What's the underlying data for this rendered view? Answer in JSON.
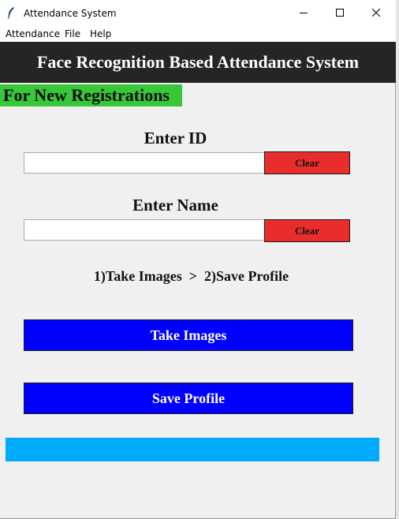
{
  "window": {
    "title": "Attendance System",
    "controls": {
      "minimize": "minimize-icon",
      "maximize": "maximize-icon",
      "close": "close-icon"
    }
  },
  "menu": {
    "items": [
      "Attendance",
      "File",
      "Help"
    ]
  },
  "header": {
    "title": "Face Recognition Based Attendance System"
  },
  "registration": {
    "banner": "For New Registrations",
    "id_label": "Enter ID",
    "id_value": "",
    "id_clear": "Clear",
    "name_label": "Enter Name",
    "name_value": "",
    "name_clear": "Clear",
    "steps": "1)Take Images  >  2)Save Profile",
    "take_images": "Take Images",
    "save_profile": "Save Profile",
    "status": ""
  },
  "colors": {
    "header_bg": "#262523",
    "banner_bg": "#38c738",
    "clear_bg": "#e92d2d",
    "action_bg": "#0000ff",
    "status_bg": "#00aaff"
  }
}
